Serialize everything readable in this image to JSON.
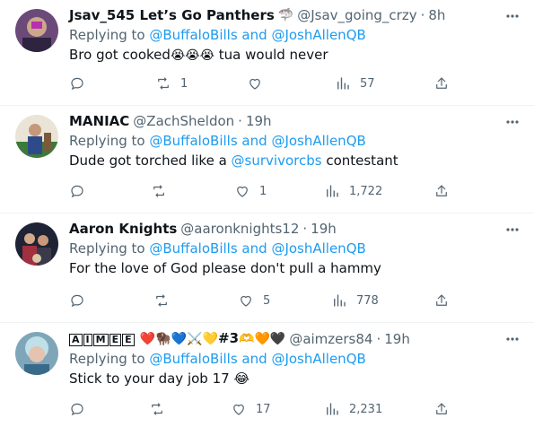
{
  "tweets": [
    {
      "name": "Jsav_545 Let’s Go Panthers",
      "name_icon": "🦈",
      "handle": "@Jsav_going_crzy",
      "time": "8h",
      "replying_label": "Replying to",
      "mention1": "@BuffaloBills",
      "and": "and",
      "mention2": "@JoshAllenQB",
      "text_before": "Bro got cooked",
      "text_emoji": "😭😭😭",
      "text_after": " tua would never",
      "replies": "",
      "retweets": "1",
      "likes": "",
      "views": "57"
    },
    {
      "name": "MANIAC",
      "handle": "@ZachSheldon",
      "time": "19h",
      "replying_label": "Replying to",
      "mention1": "@BuffaloBills",
      "and": "and",
      "mention2": "@JoshAllenQB",
      "text_before": "Dude got torched like a ",
      "text_mention": "@survivorcbs",
      "text_after": " contestant",
      "replies": "",
      "retweets": "",
      "likes": "1",
      "views": "1,722"
    },
    {
      "name": "Aaron Knights",
      "handle": "@aaronknights12",
      "time": "19h",
      "replying_label": "Replying to",
      "mention1": "@BuffaloBills",
      "and": "and",
      "mention2": "@JoshAllenQB",
      "text": "For the love of God please don't pull a hammy",
      "replies": "",
      "retweets": "",
      "likes": "5",
      "views": "778"
    },
    {
      "name_letters": [
        "A",
        "I",
        "M",
        "E",
        "E"
      ],
      "name_emoji": "❤️🦬💙⚔️💛",
      "name_num": "#3",
      "name_emoji2": "🫶🧡🖤",
      "handle": "@aimzers84",
      "time": "19h",
      "replying_label": "Replying to",
      "mention1": "@BuffaloBills",
      "and": "and",
      "mention2": "@JoshAllenQB",
      "text": "Stick to your day job 17 😂",
      "replies": "",
      "retweets": "",
      "likes": "17",
      "views": "2,231"
    }
  ],
  "colors": {
    "text": "#0f1419",
    "secondary": "#536471",
    "link": "#1d9bf0",
    "divider": "#eff3f4"
  },
  "dot": "·"
}
